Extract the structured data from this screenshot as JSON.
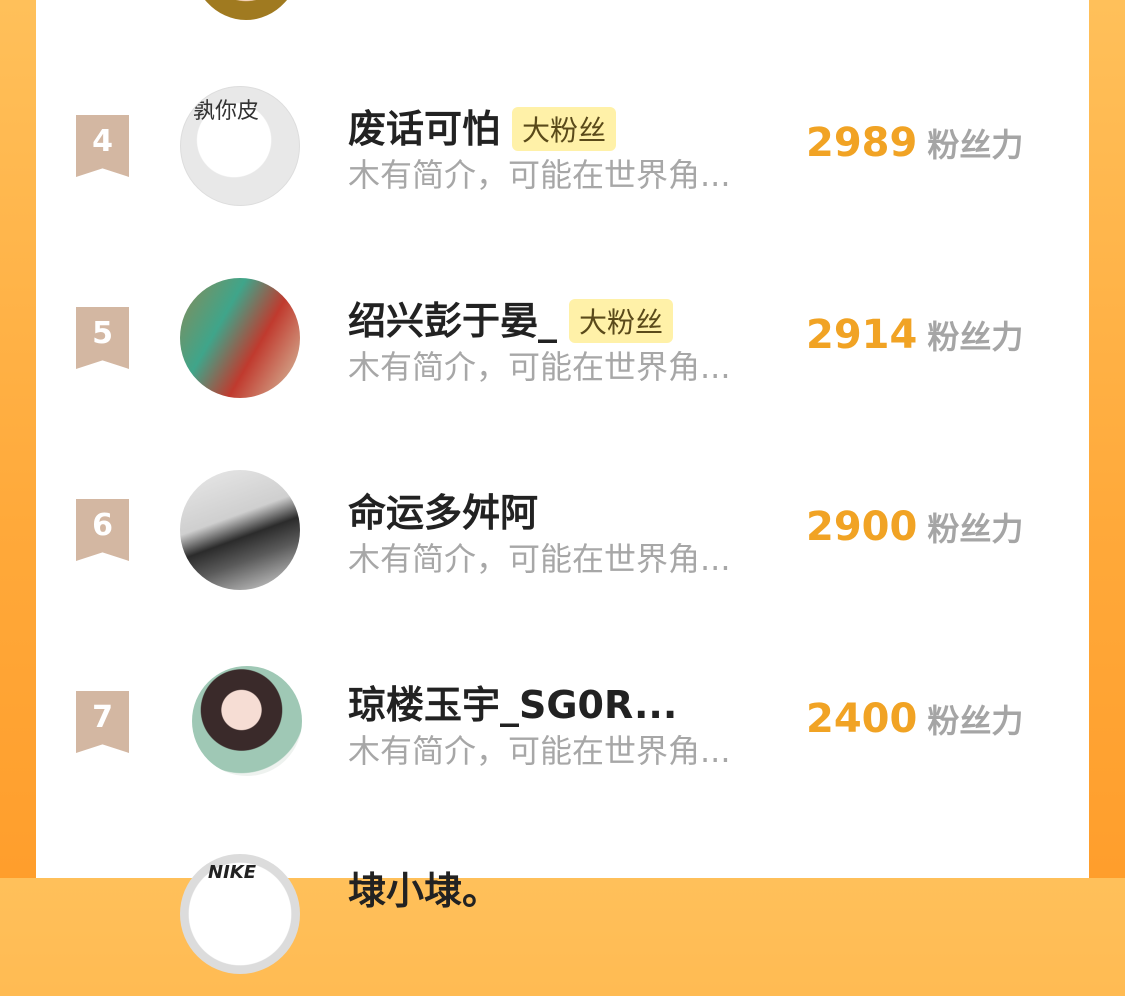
{
  "entries": [
    {
      "rank": "4",
      "name": "废话可怕",
      "badge": "大粉丝",
      "intro": "木有简介，可能在世界角...",
      "score": "2989",
      "unit": "粉丝力",
      "avatar_caption": "孰你皮"
    },
    {
      "rank": "5",
      "name": "绍兴彭于晏_",
      "badge": "大粉丝",
      "intro": "木有简介，可能在世界角...",
      "score": "2914",
      "unit": "粉丝力"
    },
    {
      "rank": "6",
      "name": "命运多舛阿",
      "badge": "",
      "intro": "木有简介，可能在世界角...",
      "score": "2900",
      "unit": "粉丝力"
    },
    {
      "rank": "7",
      "name": "琼楼玉宇_SG0R...",
      "badge": "",
      "intro": "木有简介，可能在世界角...",
      "score": "2400",
      "unit": "粉丝力"
    },
    {
      "rank": "",
      "name": "埭小埭。",
      "badge": "",
      "intro": "",
      "score": "",
      "unit": "",
      "avatar_mark": "NIKE"
    }
  ],
  "colors": {
    "background": "#ffa93a",
    "rank": "#d3b7a2",
    "score": "#f1a324",
    "badge": "#fff1a8"
  },
  "icons": [
    "avatar-top",
    "avatar-4",
    "avatar-5",
    "avatar-6",
    "avatar-7",
    "avatar-8"
  ]
}
